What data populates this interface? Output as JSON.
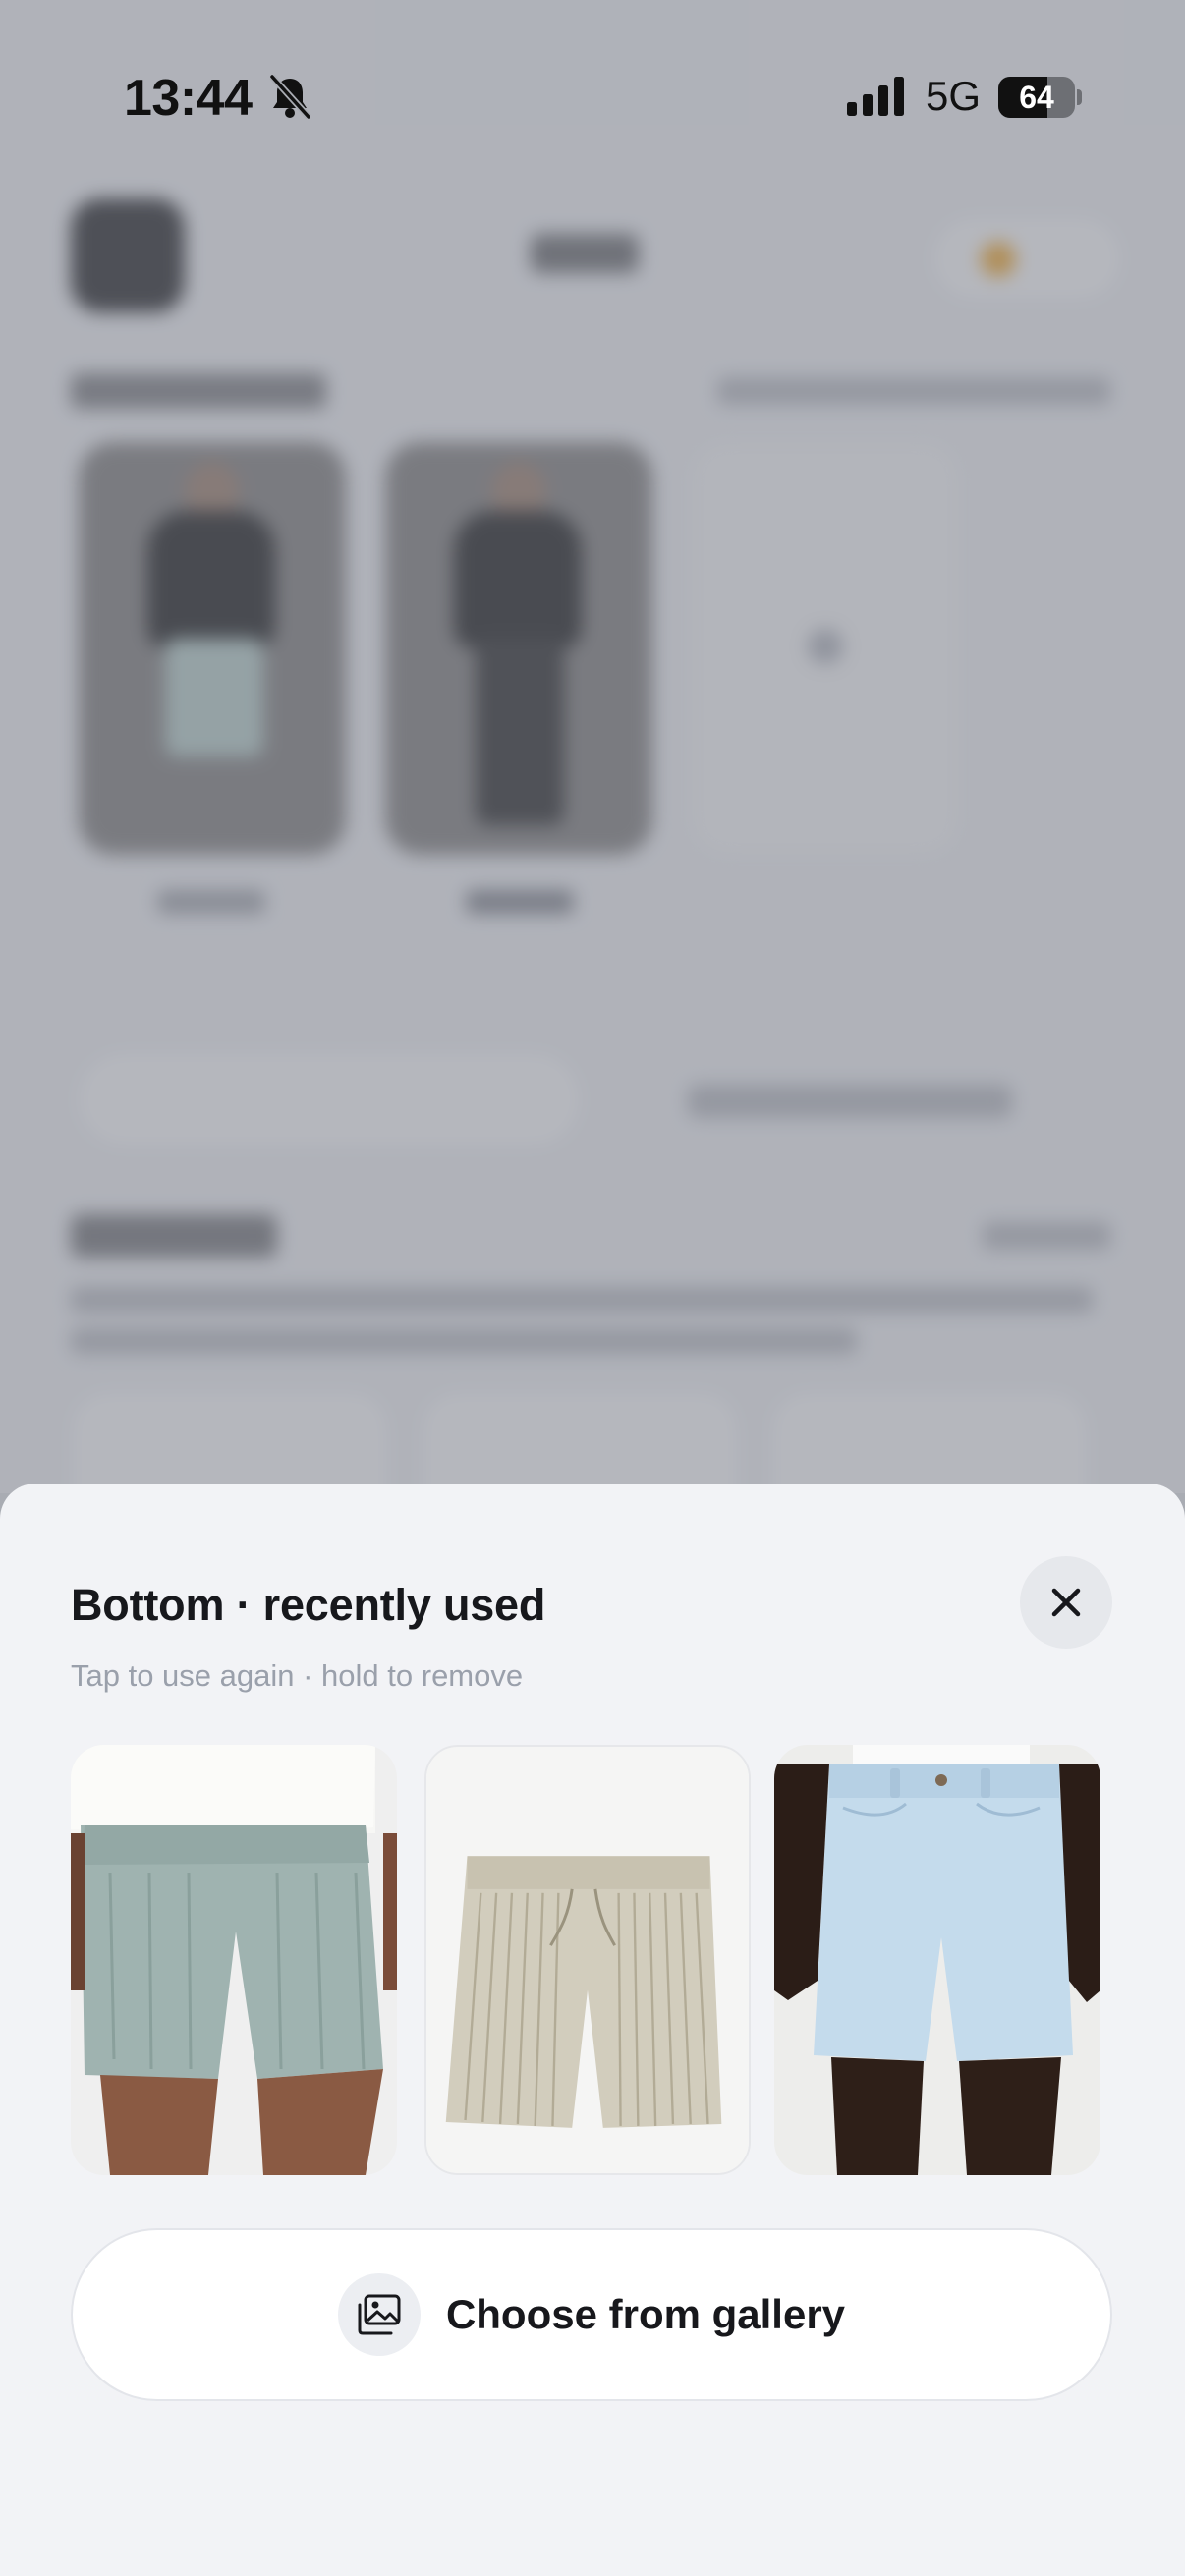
{
  "status_bar": {
    "time": "13:44",
    "network": "5G",
    "battery_percent": "64",
    "battery_level": 0.64,
    "icons": [
      "bell-slash-icon",
      "cellular-signal-icon",
      "battery-icon"
    ]
  },
  "sheet": {
    "title": "Bottom · recently used",
    "subtitle": "Tap to use again · hold to remove",
    "close_icon": "close-icon",
    "recent_items": [
      {
        "id": "sage-corduroy-shorts"
      },
      {
        "id": "beige-striped-drawstring-shorts"
      },
      {
        "id": "light-wash-denim-shorts"
      }
    ],
    "gallery_button": {
      "label": "Choose from gallery",
      "icon": "photo-gallery-icon"
    }
  },
  "colors": {
    "sheet_background": "#f2f3f6",
    "title_text": "#17181c",
    "subtitle_text": "#9aa0ab",
    "overlay": "#a9acb3"
  }
}
